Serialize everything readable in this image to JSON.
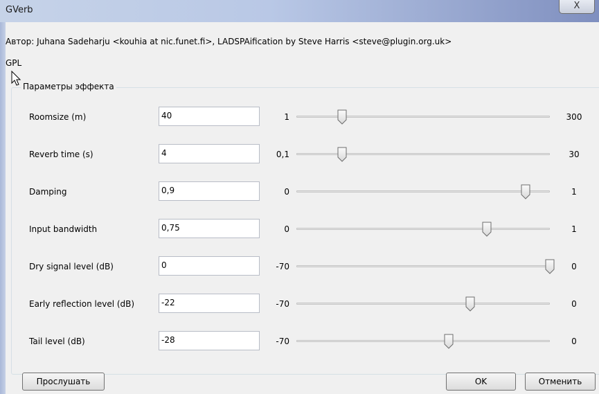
{
  "window": {
    "title": "GVerb",
    "close_glyph": "X"
  },
  "author_text": "Автор: Juhana Sadeharju <kouhia at nic.funet.fi>, LADSPAification by Steve Harris <steve@plugin.org.uk>",
  "license_text": "GPL",
  "group_title": "Параметры эффекта",
  "params": [
    {
      "label": "Roomsize (m)",
      "value": "40",
      "min": "1",
      "max": "300",
      "position": 0.181
    },
    {
      "label": "Reverb time (s)",
      "value": "4",
      "min": "0,1",
      "max": "30",
      "position": 0.181
    },
    {
      "label": "Damping",
      "value": "0,9",
      "min": "0",
      "max": "1",
      "position": 0.905
    },
    {
      "label": "Input bandwidth",
      "value": "0,75",
      "min": "0",
      "max": "1",
      "position": 0.75
    },
    {
      "label": "Dry signal level (dB)",
      "value": "0",
      "min": "-70",
      "max": "0",
      "position": 1.0
    },
    {
      "label": "Early reflection level (dB)",
      "value": "-22",
      "min": "-70",
      "max": "0",
      "position": 0.686
    },
    {
      "label": "Tail level (dB)",
      "value": "-28",
      "min": "-70",
      "max": "0",
      "position": 0.6
    }
  ],
  "buttons": {
    "preview": "Прослушать",
    "ok": "OK",
    "cancel": "Отменить"
  },
  "icons": {
    "close": "close-icon",
    "cursor": "cursor-icon"
  }
}
